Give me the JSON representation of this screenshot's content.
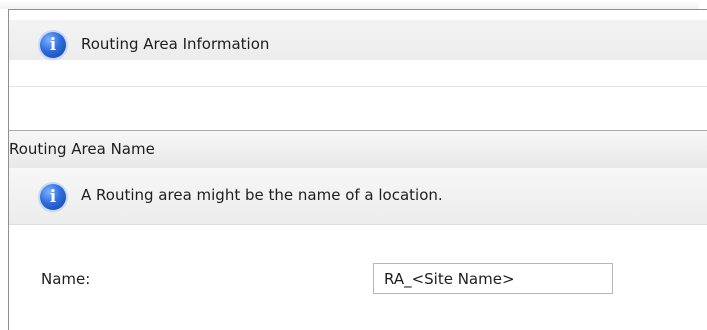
{
  "info_header": {
    "icon": "info-icon",
    "title": "Routing Area Information"
  },
  "section": {
    "title": "Routing Area Name"
  },
  "note": {
    "icon": "info-icon",
    "text": "A Routing area might be the name of a location."
  },
  "form": {
    "name_label": "Name:",
    "name_value": "RA_<Site Name>"
  }
}
